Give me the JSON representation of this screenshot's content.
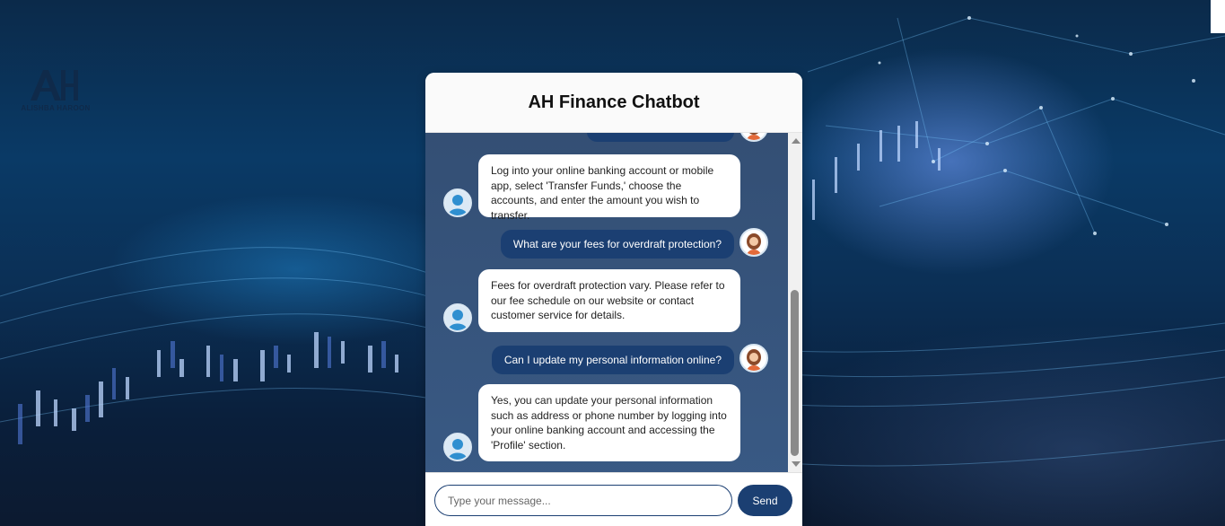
{
  "logo": {
    "initials": "AH",
    "text": "ALISHBA HAROON"
  },
  "chat": {
    "title": "AH Finance Chatbot",
    "messages": [
      {
        "role": "user",
        "text": ""
      },
      {
        "role": "bot",
        "text": "Log into your online banking account or mobile app, select 'Transfer Funds,' choose the accounts, and enter the amount you wish to transfer."
      },
      {
        "role": "user",
        "text": "What are your fees for overdraft protection?"
      },
      {
        "role": "bot",
        "text": "Fees for overdraft protection vary. Please refer to our fee schedule on our website or contact customer service for details."
      },
      {
        "role": "user",
        "text": "Can I update my personal information online?"
      },
      {
        "role": "bot",
        "text": "Yes, you can update your personal information such as address or phone number by logging into your online banking account and accessing the 'Profile' section."
      }
    ],
    "input": {
      "placeholder": "Type your message...",
      "value": ""
    },
    "send_label": "Send"
  },
  "colors": {
    "accent": "#1b3f72",
    "header_bg": "#fafafa",
    "bot_bubble": "#ffffff",
    "user_bubble": "#1b3f72"
  },
  "icons": {
    "bot_avatar": "bot-avatar-icon",
    "user_avatar": "user-avatar-icon"
  }
}
